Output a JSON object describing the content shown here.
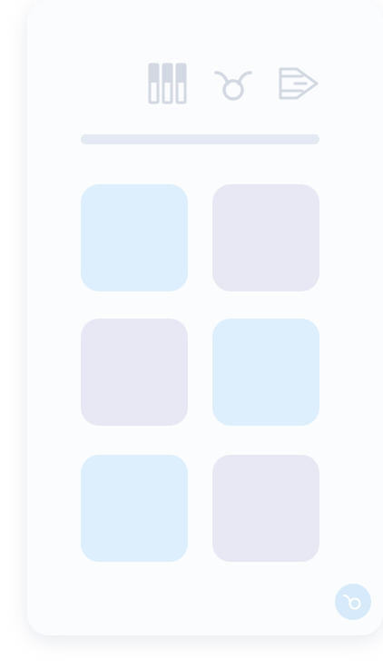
{
  "toolbar": {
    "icons": [
      "bar-chart-icon",
      "taurus-icon",
      "logout-icon"
    ]
  },
  "progress": {
    "value": 1.0
  },
  "tiles": [
    {
      "color": "#ddeefd"
    },
    {
      "color": "#e8e8f4"
    },
    {
      "color": "#e8e8f4"
    },
    {
      "color": "#ddeefd"
    },
    {
      "color": "#ddeefd"
    },
    {
      "color": "#e8e8f4"
    }
  ],
  "fab": {
    "icon": "taurus-icon",
    "color": "#d6eafc"
  },
  "colors": {
    "icon": "#d2d9e2",
    "panel": "#fbfcfe",
    "fab_icon": "#ffffff"
  }
}
